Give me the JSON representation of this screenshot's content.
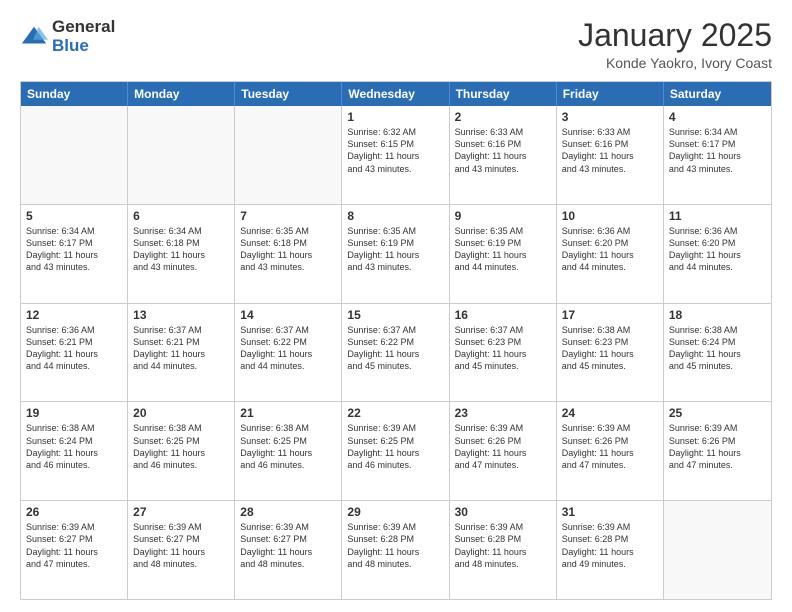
{
  "logo": {
    "general": "General",
    "blue": "Blue"
  },
  "title": {
    "month": "January 2025",
    "location": "Konde Yaokro, Ivory Coast"
  },
  "header_days": [
    "Sunday",
    "Monday",
    "Tuesday",
    "Wednesday",
    "Thursday",
    "Friday",
    "Saturday"
  ],
  "weeks": [
    [
      {
        "day": "",
        "info": "",
        "empty": true
      },
      {
        "day": "",
        "info": "",
        "empty": true
      },
      {
        "day": "",
        "info": "",
        "empty": true
      },
      {
        "day": "1",
        "info": "Sunrise: 6:32 AM\nSunset: 6:15 PM\nDaylight: 11 hours\nand 43 minutes.",
        "empty": false
      },
      {
        "day": "2",
        "info": "Sunrise: 6:33 AM\nSunset: 6:16 PM\nDaylight: 11 hours\nand 43 minutes.",
        "empty": false
      },
      {
        "day": "3",
        "info": "Sunrise: 6:33 AM\nSunset: 6:16 PM\nDaylight: 11 hours\nand 43 minutes.",
        "empty": false
      },
      {
        "day": "4",
        "info": "Sunrise: 6:34 AM\nSunset: 6:17 PM\nDaylight: 11 hours\nand 43 minutes.",
        "empty": false
      }
    ],
    [
      {
        "day": "5",
        "info": "Sunrise: 6:34 AM\nSunset: 6:17 PM\nDaylight: 11 hours\nand 43 minutes.",
        "empty": false
      },
      {
        "day": "6",
        "info": "Sunrise: 6:34 AM\nSunset: 6:18 PM\nDaylight: 11 hours\nand 43 minutes.",
        "empty": false
      },
      {
        "day": "7",
        "info": "Sunrise: 6:35 AM\nSunset: 6:18 PM\nDaylight: 11 hours\nand 43 minutes.",
        "empty": false
      },
      {
        "day": "8",
        "info": "Sunrise: 6:35 AM\nSunset: 6:19 PM\nDaylight: 11 hours\nand 43 minutes.",
        "empty": false
      },
      {
        "day": "9",
        "info": "Sunrise: 6:35 AM\nSunset: 6:19 PM\nDaylight: 11 hours\nand 44 minutes.",
        "empty": false
      },
      {
        "day": "10",
        "info": "Sunrise: 6:36 AM\nSunset: 6:20 PM\nDaylight: 11 hours\nand 44 minutes.",
        "empty": false
      },
      {
        "day": "11",
        "info": "Sunrise: 6:36 AM\nSunset: 6:20 PM\nDaylight: 11 hours\nand 44 minutes.",
        "empty": false
      }
    ],
    [
      {
        "day": "12",
        "info": "Sunrise: 6:36 AM\nSunset: 6:21 PM\nDaylight: 11 hours\nand 44 minutes.",
        "empty": false
      },
      {
        "day": "13",
        "info": "Sunrise: 6:37 AM\nSunset: 6:21 PM\nDaylight: 11 hours\nand 44 minutes.",
        "empty": false
      },
      {
        "day": "14",
        "info": "Sunrise: 6:37 AM\nSunset: 6:22 PM\nDaylight: 11 hours\nand 44 minutes.",
        "empty": false
      },
      {
        "day": "15",
        "info": "Sunrise: 6:37 AM\nSunset: 6:22 PM\nDaylight: 11 hours\nand 45 minutes.",
        "empty": false
      },
      {
        "day": "16",
        "info": "Sunrise: 6:37 AM\nSunset: 6:23 PM\nDaylight: 11 hours\nand 45 minutes.",
        "empty": false
      },
      {
        "day": "17",
        "info": "Sunrise: 6:38 AM\nSunset: 6:23 PM\nDaylight: 11 hours\nand 45 minutes.",
        "empty": false
      },
      {
        "day": "18",
        "info": "Sunrise: 6:38 AM\nSunset: 6:24 PM\nDaylight: 11 hours\nand 45 minutes.",
        "empty": false
      }
    ],
    [
      {
        "day": "19",
        "info": "Sunrise: 6:38 AM\nSunset: 6:24 PM\nDaylight: 11 hours\nand 46 minutes.",
        "empty": false
      },
      {
        "day": "20",
        "info": "Sunrise: 6:38 AM\nSunset: 6:25 PM\nDaylight: 11 hours\nand 46 minutes.",
        "empty": false
      },
      {
        "day": "21",
        "info": "Sunrise: 6:38 AM\nSunset: 6:25 PM\nDaylight: 11 hours\nand 46 minutes.",
        "empty": false
      },
      {
        "day": "22",
        "info": "Sunrise: 6:39 AM\nSunset: 6:25 PM\nDaylight: 11 hours\nand 46 minutes.",
        "empty": false
      },
      {
        "day": "23",
        "info": "Sunrise: 6:39 AM\nSunset: 6:26 PM\nDaylight: 11 hours\nand 47 minutes.",
        "empty": false
      },
      {
        "day": "24",
        "info": "Sunrise: 6:39 AM\nSunset: 6:26 PM\nDaylight: 11 hours\nand 47 minutes.",
        "empty": false
      },
      {
        "day": "25",
        "info": "Sunrise: 6:39 AM\nSunset: 6:26 PM\nDaylight: 11 hours\nand 47 minutes.",
        "empty": false
      }
    ],
    [
      {
        "day": "26",
        "info": "Sunrise: 6:39 AM\nSunset: 6:27 PM\nDaylight: 11 hours\nand 47 minutes.",
        "empty": false
      },
      {
        "day": "27",
        "info": "Sunrise: 6:39 AM\nSunset: 6:27 PM\nDaylight: 11 hours\nand 48 minutes.",
        "empty": false
      },
      {
        "day": "28",
        "info": "Sunrise: 6:39 AM\nSunset: 6:27 PM\nDaylight: 11 hours\nand 48 minutes.",
        "empty": false
      },
      {
        "day": "29",
        "info": "Sunrise: 6:39 AM\nSunset: 6:28 PM\nDaylight: 11 hours\nand 48 minutes.",
        "empty": false
      },
      {
        "day": "30",
        "info": "Sunrise: 6:39 AM\nSunset: 6:28 PM\nDaylight: 11 hours\nand 48 minutes.",
        "empty": false
      },
      {
        "day": "31",
        "info": "Sunrise: 6:39 AM\nSunset: 6:28 PM\nDaylight: 11 hours\nand 49 minutes.",
        "empty": false
      },
      {
        "day": "",
        "info": "",
        "empty": true
      }
    ]
  ]
}
